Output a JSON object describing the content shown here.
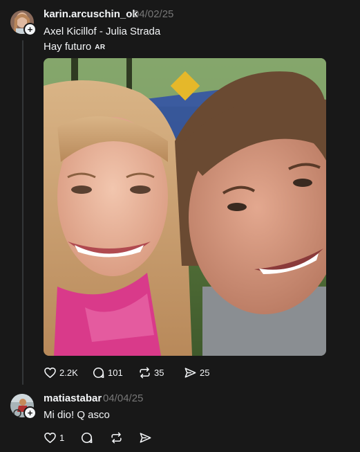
{
  "post": {
    "username": "karin.arcuschin_ok",
    "date": "04/02/25",
    "line1": "Axel Kicillof - Julia Strada",
    "line2": "Hay futuro",
    "flag": "AR",
    "actions": {
      "likes": "2.2K",
      "replies": "101",
      "reposts": "35",
      "shares": "25"
    }
  },
  "reply": {
    "username": "matiastabar",
    "date": "04/04/25",
    "text": "Mi dio! Q asco",
    "actions": {
      "likes": "1"
    }
  },
  "colors": {
    "background": "#181818",
    "text": "#f3f5f7",
    "muted": "#777777",
    "thread_line": "#333638"
  },
  "icons": [
    "heart-icon",
    "comment-icon",
    "repost-icon",
    "share-icon",
    "follow-plus-icon"
  ]
}
